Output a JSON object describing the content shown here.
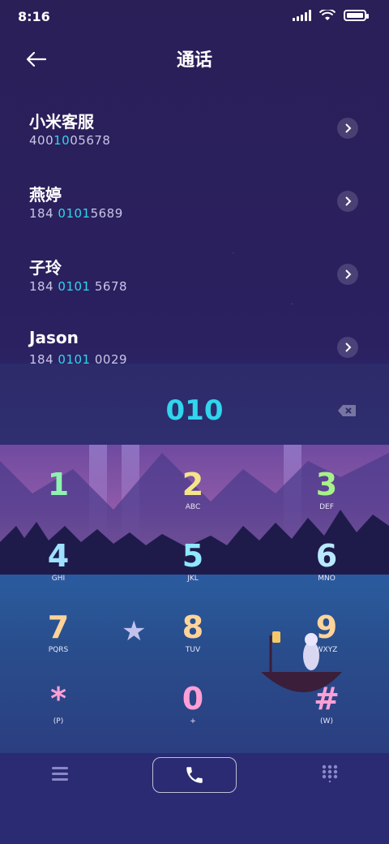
{
  "status_bar": {
    "time": "8:16"
  },
  "header": {
    "title": "通话"
  },
  "contacts": [
    {
      "name": "小米客服",
      "num_pre": "400",
      "num_hl": "10",
      "num_post": "05678"
    },
    {
      "name": "燕婷",
      "num_pre": "184 ",
      "num_hl": "0101",
      "num_post": "5689"
    },
    {
      "name": "子玲",
      "num_pre": "184 ",
      "num_hl": "0101",
      "num_post": " 5678"
    },
    {
      "name": "Jason",
      "num_pre": "184 ",
      "num_hl": "0101",
      "num_post": " 0029"
    }
  ],
  "dialer": {
    "input": "010"
  },
  "keys": [
    {
      "digit": "1",
      "letters": "ᅟ"
    },
    {
      "digit": "2",
      "letters": "ABC"
    },
    {
      "digit": "3",
      "letters": "DEF"
    },
    {
      "digit": "4",
      "letters": "GHI"
    },
    {
      "digit": "5",
      "letters": "JKL"
    },
    {
      "digit": "6",
      "letters": "MNO"
    },
    {
      "digit": "7",
      "letters": "PQRS"
    },
    {
      "digit": "8",
      "letters": "TUV"
    },
    {
      "digit": "9",
      "letters": "WXYZ"
    },
    {
      "digit": "*",
      "letters": "(P)"
    },
    {
      "digit": "0",
      "letters": "+"
    },
    {
      "digit": "#",
      "letters": "(W)"
    }
  ],
  "colors": {
    "highlight": "#2fd6ee"
  },
  "icons": {
    "back": "back-arrow-icon",
    "call": "phone-icon",
    "menu": "menu-icon",
    "keypad": "keypad-grid-icon",
    "backspace": "backspace-icon"
  }
}
